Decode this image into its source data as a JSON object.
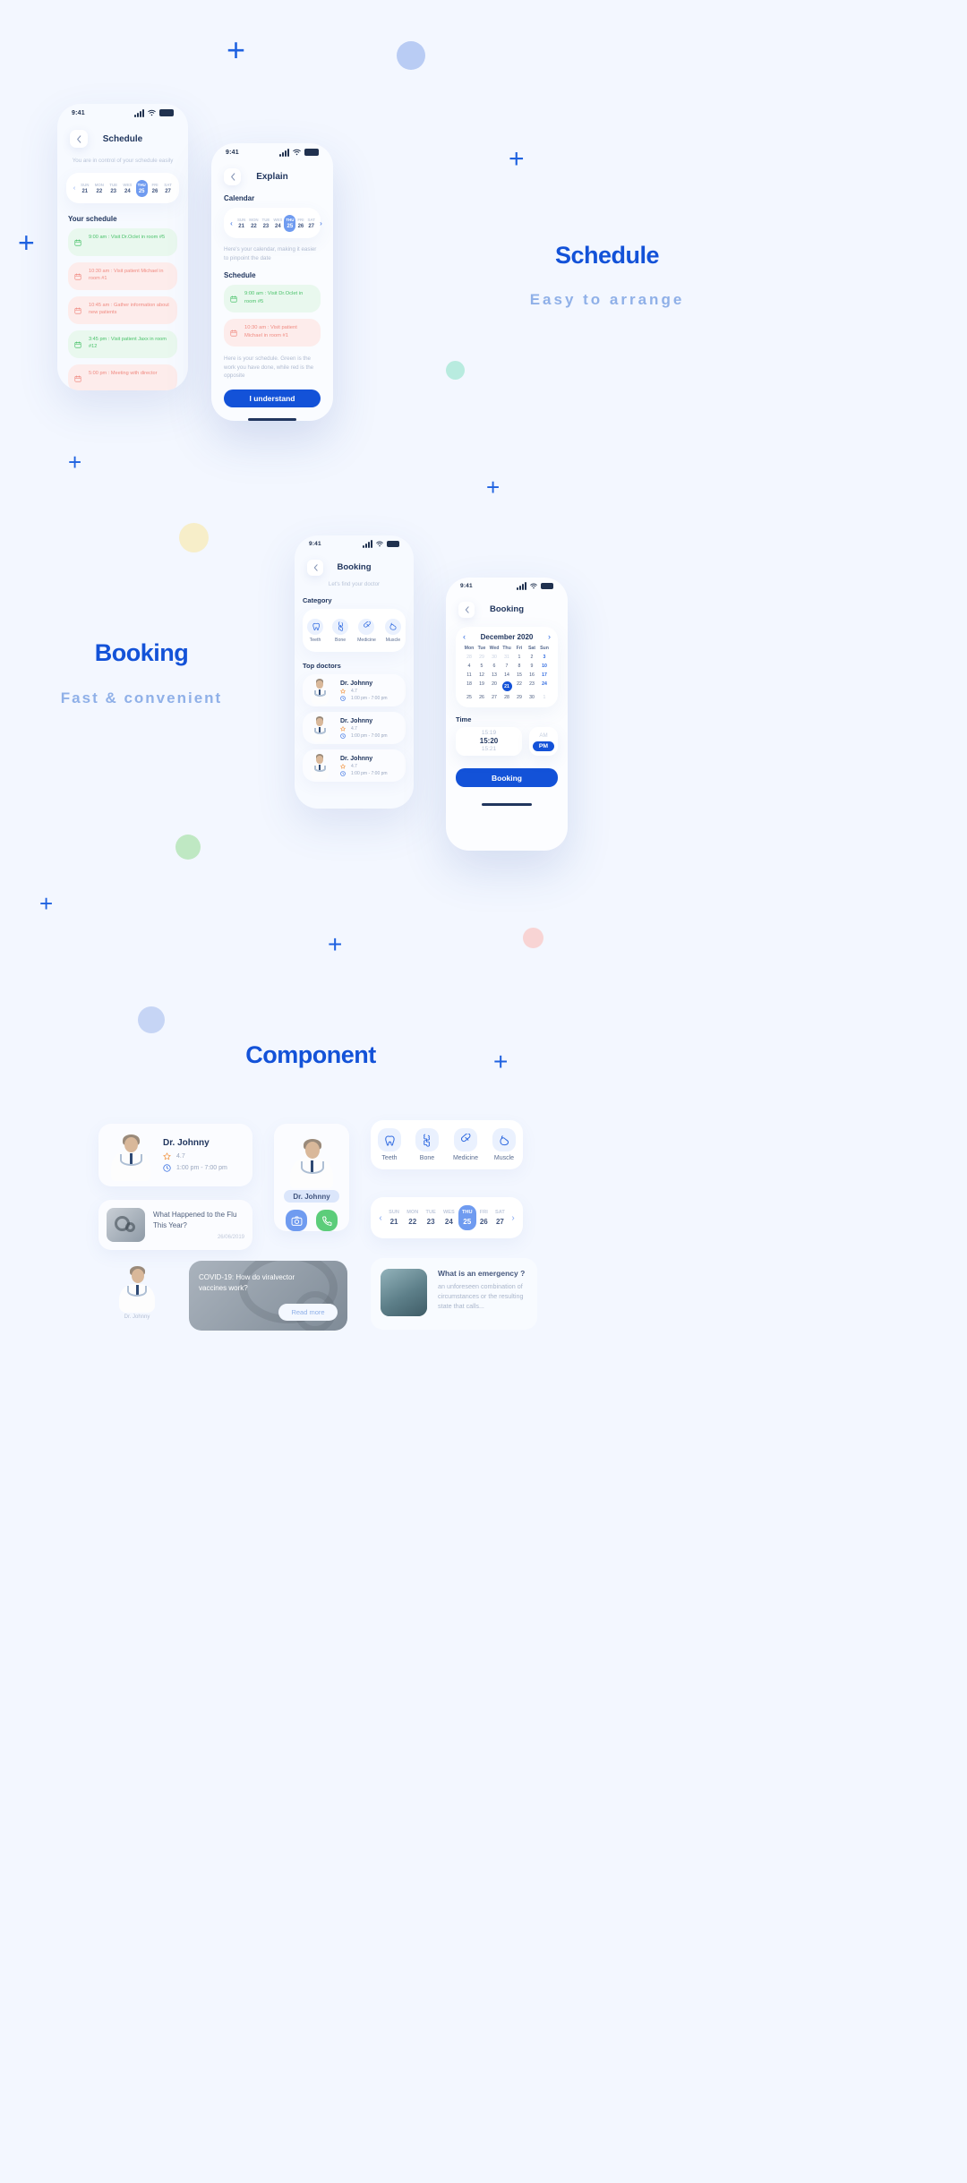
{
  "theme": {
    "bg": "#f3f7ff",
    "accent": "#1352d8",
    "accent_soft": "#6f9bf0",
    "muted": "#8fb0e8",
    "green": "#4bc26b",
    "red": "#f08b82"
  },
  "sections": [
    {
      "title": "Schedule",
      "subtitle": "Easy to arrange"
    },
    {
      "title": "Booking",
      "subtitle": "Fast & convenient"
    },
    {
      "title": "Component",
      "subtitle": ""
    }
  ],
  "schedule_screen": {
    "status_time": "9:41",
    "nav_title": "Schedule",
    "back_icon": "chevron-left-icon",
    "subtitle": "You are in control of your schedule easily",
    "week": {
      "prev_icon": "chevron-left-icon",
      "next_icon": "chevron-right-icon",
      "days": [
        {
          "dow": "SUN",
          "num": "21",
          "selected": false
        },
        {
          "dow": "MON",
          "num": "22",
          "selected": false
        },
        {
          "dow": "TUE",
          "num": "23",
          "selected": false
        },
        {
          "dow": "WES",
          "num": "24",
          "selected": false
        },
        {
          "dow": "THU",
          "num": "25",
          "selected": true
        },
        {
          "dow": "FRI",
          "num": "26",
          "selected": false
        },
        {
          "dow": "SAT",
          "num": "27",
          "selected": false
        }
      ]
    },
    "list_label": "Your schedule",
    "items": [
      {
        "text": "9:00 am : Visit Dr.Oclet in room #5",
        "tone": "green"
      },
      {
        "text": "10:30 am : Visit patient Michael in room #1",
        "tone": "red"
      },
      {
        "text": "10:45 am : Gather information about new patients",
        "tone": "red"
      },
      {
        "text": "3:45 pm : Visit patient Jaxx in room #12",
        "tone": "green"
      },
      {
        "text": "5:00 pm : Meeting with director",
        "tone": "red"
      }
    ]
  },
  "explain_screen": {
    "status_time": "9:41",
    "nav_title": "Explain",
    "back_icon": "chevron-left-icon",
    "calendar_label": "Calendar",
    "week": {
      "prev_icon": "chevron-left-icon",
      "next_icon": "chevron-right-icon",
      "days": [
        {
          "dow": "SUN",
          "num": "21",
          "selected": false
        },
        {
          "dow": "MON",
          "num": "22",
          "selected": false
        },
        {
          "dow": "TUE",
          "num": "23",
          "selected": false
        },
        {
          "dow": "WES",
          "num": "24",
          "selected": false
        },
        {
          "dow": "THU",
          "num": "25",
          "selected": true
        },
        {
          "dow": "FRI",
          "num": "26",
          "selected": false
        },
        {
          "dow": "SAT",
          "num": "27",
          "selected": false
        }
      ]
    },
    "calendar_note": "Here's your calendar, making it easier to pinpoint the date",
    "schedule_label": "Schedule",
    "items": [
      {
        "text": "9:00 am : Visit Dr.Oclet in room #5",
        "tone": "green"
      },
      {
        "text": "10:30 am : Visit patient Michael in room #1",
        "tone": "red"
      }
    ],
    "schedule_note": "Here is your schedule. Green is the work you have done, while red is the opposite",
    "cta": "I understand"
  },
  "booking_list_screen": {
    "status_time": "9:41",
    "nav_title": "Booking",
    "back_icon": "chevron-left-icon",
    "subtitle": "Let's find your doctor",
    "category_label": "Category",
    "categories": [
      {
        "label": "Teeth",
        "icon": "tooth-icon"
      },
      {
        "label": "Bone",
        "icon": "bone-icon"
      },
      {
        "label": "Medicine",
        "icon": "capsule-icon"
      },
      {
        "label": "Muscle",
        "icon": "muscle-icon"
      }
    ],
    "doctors_label": "Top doctors",
    "doctors": [
      {
        "name": "Dr. Johnny",
        "rating": "4.7",
        "hours": "1:00 pm - 7:00 pm",
        "star_icon": "star-icon",
        "clock_icon": "clock-icon"
      },
      {
        "name": "Dr. Johnny",
        "rating": "4.7",
        "hours": "1:00 pm - 7:00 pm",
        "star_icon": "star-icon",
        "clock_icon": "clock-icon"
      },
      {
        "name": "Dr. Johnny",
        "rating": "4.7",
        "hours": "1:00 pm - 7:00 pm",
        "star_icon": "star-icon",
        "clock_icon": "clock-icon"
      }
    ]
  },
  "booking_date_screen": {
    "status_time": "9:41",
    "nav_title": "Booking",
    "back_icon": "chevron-left-icon",
    "month": "December 2020",
    "prev_icon": "chevron-left-icon",
    "next_icon": "chevron-right-icon",
    "dow": [
      "Mon",
      "Tue",
      "Wed",
      "Thu",
      "Fri",
      "Sat",
      "Sun"
    ],
    "weeks": [
      [
        {
          "d": "28",
          "s": "mut"
        },
        {
          "d": "29",
          "s": "mut"
        },
        {
          "d": "30",
          "s": "mut"
        },
        {
          "d": "31",
          "s": "mut"
        },
        {
          "d": "1",
          "s": ""
        },
        {
          "d": "2",
          "s": ""
        },
        {
          "d": "3",
          "s": "sun"
        }
      ],
      [
        {
          "d": "4",
          "s": ""
        },
        {
          "d": "5",
          "s": ""
        },
        {
          "d": "6",
          "s": ""
        },
        {
          "d": "7",
          "s": ""
        },
        {
          "d": "8",
          "s": ""
        },
        {
          "d": "9",
          "s": ""
        },
        {
          "d": "10",
          "s": "sun"
        }
      ],
      [
        {
          "d": "11",
          "s": ""
        },
        {
          "d": "12",
          "s": ""
        },
        {
          "d": "13",
          "s": ""
        },
        {
          "d": "14",
          "s": ""
        },
        {
          "d": "15",
          "s": ""
        },
        {
          "d": "16",
          "s": ""
        },
        {
          "d": "17",
          "s": "sun"
        }
      ],
      [
        {
          "d": "18",
          "s": ""
        },
        {
          "d": "19",
          "s": ""
        },
        {
          "d": "20",
          "s": ""
        },
        {
          "d": "21",
          "s": "today"
        },
        {
          "d": "22",
          "s": ""
        },
        {
          "d": "23",
          "s": ""
        },
        {
          "d": "24",
          "s": "sun"
        }
      ],
      [
        {
          "d": "25",
          "s": ""
        },
        {
          "d": "26",
          "s": ""
        },
        {
          "d": "27",
          "s": ""
        },
        {
          "d": "28",
          "s": ""
        },
        {
          "d": "29",
          "s": ""
        },
        {
          "d": "30",
          "s": ""
        },
        {
          "d": "1",
          "s": "mut"
        }
      ]
    ],
    "time_label": "Time",
    "time_above": "15:19",
    "time_selected": "15:20",
    "time_below": "15:21",
    "am_label": "AM",
    "pm_label": "PM",
    "cta": "Booking"
  },
  "component": {
    "doctor_card": {
      "name": "Dr. Johnny",
      "rating": "4.7",
      "hours": "1:00 pm - 7:00 pm",
      "star_icon": "star-icon",
      "clock_icon": "clock-icon"
    },
    "news_card": {
      "title": "What Happened to the Flu This Year?",
      "date": "26/06/2019",
      "thumb_icon": "stethoscope-photo"
    },
    "profile_card": {
      "name": "Dr. Johnny",
      "buttons": [
        {
          "icon": "camera-icon",
          "tone": "blue"
        },
        {
          "icon": "phone-icon",
          "tone": "green"
        }
      ]
    },
    "categories": [
      {
        "label": "Teeth",
        "icon": "tooth-icon"
      },
      {
        "label": "Bone",
        "icon": "bone-icon"
      },
      {
        "label": "Medicine",
        "icon": "capsule-icon"
      },
      {
        "label": "Muscle",
        "icon": "muscle-icon"
      }
    ],
    "week": {
      "prev_icon": "chevron-left-icon",
      "next_icon": "chevron-right-icon",
      "days": [
        {
          "dow": "SUN",
          "num": "21",
          "selected": false
        },
        {
          "dow": "MON",
          "num": "22",
          "selected": false
        },
        {
          "dow": "TUE",
          "num": "23",
          "selected": false
        },
        {
          "dow": "WES",
          "num": "24",
          "selected": false
        },
        {
          "dow": "THU",
          "num": "25",
          "selected": true
        },
        {
          "dow": "FRI",
          "num": "26",
          "selected": false
        },
        {
          "dow": "SAT",
          "num": "27",
          "selected": false
        }
      ]
    },
    "mini_profile": {
      "name": "Dr. Johnny"
    },
    "banner": {
      "title": "COVID-19: How do viralvector vaccines work?",
      "button": "Read more"
    },
    "emergency": {
      "title": "What is an emergency ?",
      "body": "an unforeseen combination of circumstances or the resulting state that calls..."
    }
  }
}
